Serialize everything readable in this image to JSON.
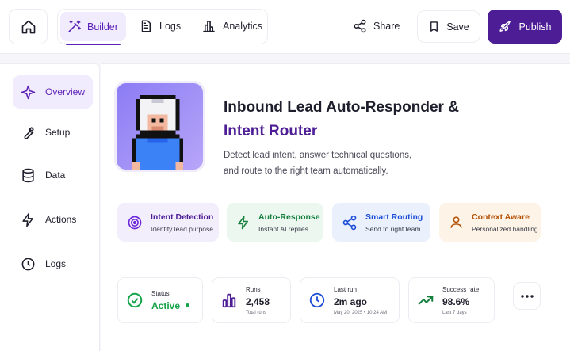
{
  "topbar": {
    "tabs": [
      {
        "label": "Builder",
        "icon": "magic-wand-icon",
        "active": true
      },
      {
        "label": "Logs",
        "icon": "document-icon"
      },
      {
        "label": "Analytics",
        "icon": "bar-chart-icon"
      }
    ],
    "share_label": "Share",
    "save_label": "Save",
    "publish_label": "Publish"
  },
  "sidebar": {
    "items": [
      {
        "label": "Overview",
        "icon": "sparkle-icon",
        "active": true
      },
      {
        "label": "Setup",
        "icon": "wrench-icon"
      },
      {
        "label": "Data",
        "icon": "database-icon"
      },
      {
        "label": "Actions",
        "icon": "lightning-icon"
      },
      {
        "label": "Logs",
        "icon": "clock-icon"
      }
    ]
  },
  "agent": {
    "title_line1": "Inbound Lead Auto-Responder &",
    "title_line2": "Intent Router",
    "description_line1": "Detect lead intent, answer technical questions,",
    "description_line2": "and route to the right team automatically."
  },
  "features": [
    {
      "title": "Intent Detection",
      "subtitle": "Identify lead purpose",
      "icon": "target-icon",
      "color": "#6d28d9",
      "bg": "#f3eefc"
    },
    {
      "title": "Auto-Response",
      "subtitle": "Instant AI replies",
      "icon": "lightning-icon",
      "color": "#15803d",
      "bg": "#ecf7f0"
    },
    {
      "title": "Smart Routing",
      "subtitle": "Send to right team",
      "icon": "share-nodes-icon",
      "color": "#1d4ed8",
      "bg": "#eaf1fd"
    },
    {
      "title": "Context Aware",
      "subtitle": "Personalized handling",
      "icon": "user-icon",
      "color": "#b45309",
      "bg": "#fdf3e6"
    }
  ],
  "stats": {
    "status": {
      "label": "Status",
      "value": "Active",
      "color": "#16a34a"
    },
    "runs": {
      "label": "Runs",
      "value": "2,458",
      "sub": "Total runs"
    },
    "last_run": {
      "label": "Last run",
      "value": "2m ago",
      "sub": "May 20, 2025 • 10:24 AM"
    },
    "success": {
      "label": "Success rate",
      "value": "98.6%",
      "sub": "Last 7 days"
    }
  },
  "colors": {
    "accent": "#5b21b6",
    "accent_light": "#f1ecfd",
    "publish_bg": "#4c1d95"
  }
}
